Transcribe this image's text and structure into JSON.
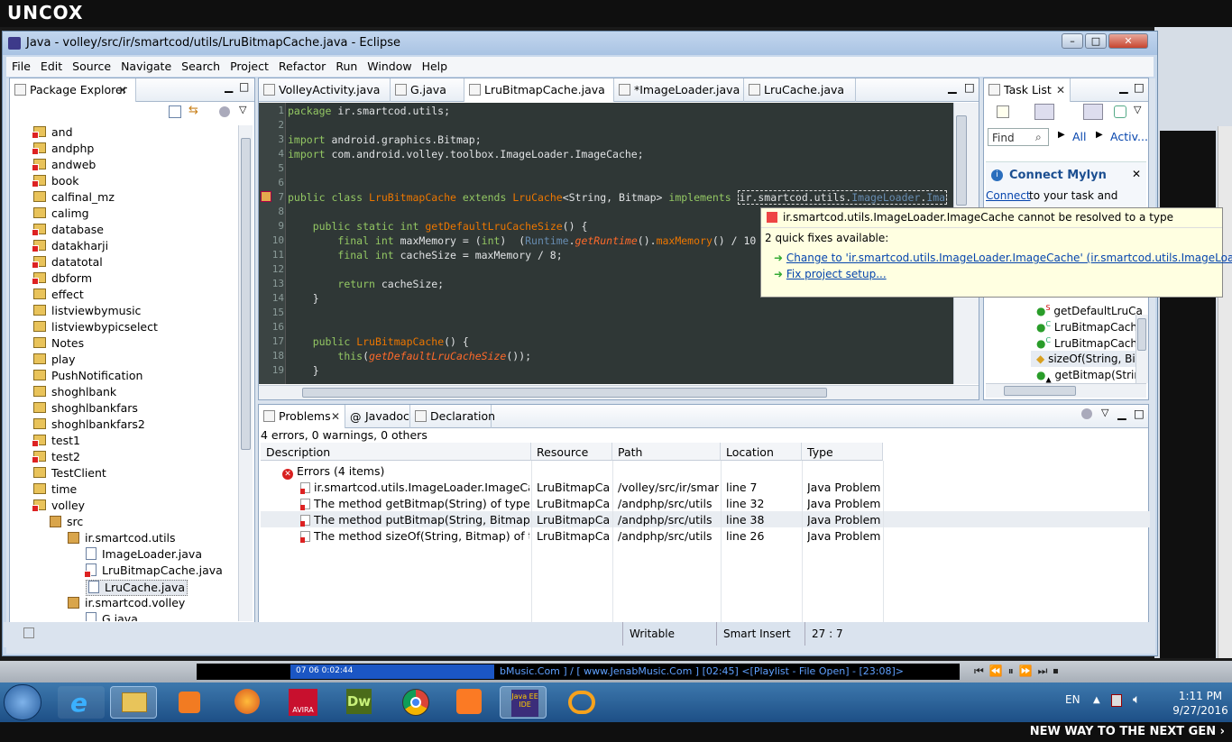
{
  "brand": "UNCOX",
  "footer_tagline": "NEW WAY TO THE NEXT GEN ›",
  "window": {
    "title": "Java - volley/src/ir/smartcod/utils/LruBitmapCache.java - Eclipse"
  },
  "menu": [
    "File",
    "Edit",
    "Source",
    "Navigate",
    "Search",
    "Project",
    "Refactor",
    "Run",
    "Window",
    "Help"
  ],
  "package_explorer": {
    "title": "Package Explorer",
    "items": [
      {
        "label": "and",
        "type": "project",
        "error": true
      },
      {
        "label": "andphp",
        "type": "project",
        "error": true
      },
      {
        "label": "andweb",
        "type": "project",
        "error": true
      },
      {
        "label": "book",
        "type": "project",
        "error": true
      },
      {
        "label": "calfinal_mz",
        "type": "project",
        "error": false
      },
      {
        "label": "calimg",
        "type": "project",
        "error": false
      },
      {
        "label": "database",
        "type": "project",
        "error": true
      },
      {
        "label": "datakharji",
        "type": "project",
        "error": true
      },
      {
        "label": "datatotal",
        "type": "project",
        "error": true
      },
      {
        "label": "dbform",
        "type": "project",
        "error": true
      },
      {
        "label": "effect",
        "type": "project",
        "error": false
      },
      {
        "label": "listviewbymusic",
        "type": "project",
        "error": false
      },
      {
        "label": "listviewbypicselect",
        "type": "project",
        "error": false
      },
      {
        "label": "Notes",
        "type": "project",
        "error": false
      },
      {
        "label": "play",
        "type": "project",
        "error": false
      },
      {
        "label": "PushNotification",
        "type": "project",
        "error": false
      },
      {
        "label": "shoghlbank",
        "type": "project",
        "error": false
      },
      {
        "label": "shoghlbankfars",
        "type": "project",
        "error": false
      },
      {
        "label": "shoghlbankfars2",
        "type": "project",
        "error": false
      },
      {
        "label": "test1",
        "type": "project",
        "error": true
      },
      {
        "label": "test2",
        "type": "project",
        "error": true
      },
      {
        "label": "TestClient",
        "type": "project",
        "error": false
      },
      {
        "label": "time",
        "type": "project",
        "error": false
      },
      {
        "label": "volley",
        "type": "project",
        "error": true
      },
      {
        "label": "src",
        "type": "src",
        "error": true
      },
      {
        "label": "ir.smartcod.utils",
        "type": "package",
        "error": true
      },
      {
        "label": "ImageLoader.java",
        "type": "file",
        "error": false
      },
      {
        "label": "LruBitmapCache.java",
        "type": "file",
        "error": true
      },
      {
        "label": "LruCache.java",
        "type": "file",
        "error": false,
        "selected": true
      },
      {
        "label": "ir.smartcod.volley",
        "type": "package",
        "error": false
      },
      {
        "label": "G.java",
        "type": "file",
        "error": false
      }
    ]
  },
  "editor": {
    "tabs": [
      {
        "label": "VolleyActivity.java",
        "active": false
      },
      {
        "label": "G.java",
        "active": false
      },
      {
        "label": "LruBitmapCache.java",
        "active": true
      },
      {
        "label": "*ImageLoader.java",
        "active": false
      },
      {
        "label": "LruCache.java",
        "active": false
      }
    ],
    "line_numbers": [
      "1",
      "2",
      "3",
      "4",
      "5",
      "6",
      "7",
      "8",
      "9",
      "10",
      "11",
      "12",
      "13",
      "14",
      "15",
      "16",
      "17",
      "18",
      "19"
    ]
  },
  "task_list": {
    "title": "Task List",
    "find_placeholder": "Find",
    "all_label": "All",
    "activate_label": "Activ...",
    "mylyn_title": "Connect Mylyn",
    "mylyn_link": "Connect",
    "mylyn_text": "to your task and",
    "outline_items": [
      "getDefaultLruCa",
      "LruBitmapCach",
      "LruBitmapCach",
      "sizeOf(String, Bi",
      "getBitmap(Strin"
    ]
  },
  "quickfix": {
    "error": "ir.smartcod.utils.ImageLoader.ImageCache cannot be resolved to a type",
    "count_label": "2 quick fixes available:",
    "fixes": [
      "Change to 'ir.smartcod.utils.ImageLoader.ImageCache' (ir.smartcod.utils.ImageLoader)",
      "Fix project setup..."
    ]
  },
  "problems": {
    "tabs": [
      "Problems",
      "Javadoc",
      "Declaration"
    ],
    "summary": "4 errors, 0 warnings, 0 others",
    "columns": [
      "Description",
      "Resource",
      "Path",
      "Location",
      "Type"
    ],
    "group": "Errors (4 items)",
    "rows": [
      {
        "desc": "ir.smartcod.utils.ImageLoader.ImageCache ca",
        "resource": "LruBitmapCa...",
        "path": "/volley/src/ir/smart...",
        "location": "line 7",
        "type": "Java Problem"
      },
      {
        "desc": "The method getBitmap(String) of type LruBit",
        "resource": "LruBitmapCa...",
        "path": "/andphp/src/utils",
        "location": "line 32",
        "type": "Java Problem"
      },
      {
        "desc": "The method putBitmap(String, Bitmap) of typ",
        "resource": "LruBitmapCa...",
        "path": "/andphp/src/utils",
        "location": "line 38",
        "type": "Java Problem"
      },
      {
        "desc": "The method sizeOf(String, Bitmap) of type Lr",
        "resource": "LruBitmapCa...",
        "path": "/andphp/src/utils",
        "location": "line 26",
        "type": "Java Problem"
      }
    ]
  },
  "status": {
    "writable": "Writable",
    "insert": "Smart Insert",
    "position": "27 : 7"
  },
  "media": {
    "track_info": "bMusic.Com ] / [ www.JenabMusic.Com ]  [02:45]  <[Playlist - File Open] - [23:08]>",
    "time_display": "07   06   0:02:44"
  },
  "taskbar": {
    "language": "EN",
    "time": "1:11 PM",
    "date": "9/27/2016"
  },
  "colors": {
    "editor_bg": "#2f3736",
    "keyword": "#93c763",
    "taskbar": "#1d4f86"
  }
}
